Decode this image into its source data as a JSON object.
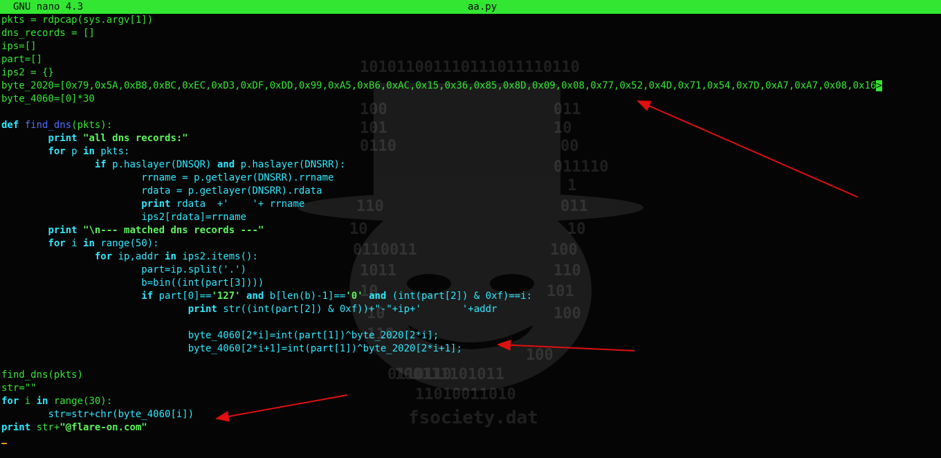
{
  "titlebar": {
    "app": "GNU nano 4.3",
    "file": "aa.py"
  },
  "colors": {
    "accent": "#32e632",
    "keyword": "#2fe8ff",
    "function": "#4f6dff",
    "annotation_arrow": "#e01010"
  },
  "watermark": {
    "binary_rows": [
      "101011001110111011110110",
      "100",
      "011",
      "101",
      "10",
      "0110",
      "00",
      "011110",
      "1",
      "110",
      "011",
      "10",
      "10",
      "0110011",
      "100",
      "1011",
      "110",
      "10",
      "101",
      "10",
      "100",
      "110",
      "100",
      "0110110",
      "100111101011",
      "11010011010"
    ],
    "caption": "fsociety.dat"
  },
  "code": [
    [
      [
        "d",
        "pkts = rdpcap(sys.argv[1])"
      ]
    ],
    [
      [
        "d",
        "dns_records = []"
      ]
    ],
    [
      [
        "d",
        "ips=[]"
      ]
    ],
    [
      [
        "d",
        "part=[]"
      ]
    ],
    [
      [
        "d",
        "ips2 = {}"
      ]
    ],
    [
      [
        "d",
        "byte_2020=[0x79,0x5A,0xB8,0xBC,0xEC,0xD3,0xDF,0xDD,0x99,0xA5,0xB6,0xAC,0x15,0x36,0x85,0x8D,0x09,0x08,0x77,0x52,0x4D,0x71,0x54,0x7D,0xA7,0xA7,0x08,0x16"
      ],
      [
        "m",
        ">"
      ]
    ],
    [
      [
        "d",
        "byte_4060=[0]*30"
      ]
    ],
    [],
    [
      [
        "k",
        "def "
      ],
      [
        "f",
        "find_dns"
      ],
      [
        "d",
        "(pkts):"
      ]
    ],
    [
      [
        "d",
        "        "
      ],
      [
        "k",
        "print "
      ],
      [
        "s",
        "\"all dns records:\""
      ]
    ],
    [
      [
        "d",
        "        "
      ],
      [
        "k",
        "for "
      ],
      [
        "t",
        "p "
      ],
      [
        "k",
        "in "
      ],
      [
        "t",
        "pkts:"
      ]
    ],
    [
      [
        "d",
        "                "
      ],
      [
        "k",
        "if "
      ],
      [
        "t",
        "p.haslayer(DNSQR) "
      ],
      [
        "k",
        "and "
      ],
      [
        "t",
        "p.haslayer(DNSRR):"
      ]
    ],
    [
      [
        "d",
        "                        "
      ],
      [
        "t",
        "rrname = p.getlayer(DNSRR).rrname"
      ]
    ],
    [
      [
        "d",
        "                        "
      ],
      [
        "t",
        "rdata = p.getlayer(DNSRR).rdata"
      ]
    ],
    [
      [
        "d",
        "                        "
      ],
      [
        "k",
        "print "
      ],
      [
        "t",
        "rdata  +'    '+ rrname"
      ]
    ],
    [
      [
        "d",
        "                        "
      ],
      [
        "t",
        "ips2[rdata]=rrname"
      ]
    ],
    [
      [
        "d",
        "        "
      ],
      [
        "k",
        "print "
      ],
      [
        "s",
        "\"\\n--- matched dns records ---\""
      ]
    ],
    [
      [
        "d",
        "        "
      ],
      [
        "k",
        "for "
      ],
      [
        "t",
        "i "
      ],
      [
        "k",
        "in "
      ],
      [
        "t",
        "range(50):"
      ]
    ],
    [
      [
        "d",
        "                "
      ],
      [
        "k",
        "for "
      ],
      [
        "t",
        "ip,addr "
      ],
      [
        "k",
        "in "
      ],
      [
        "t",
        "ips2.items():"
      ]
    ],
    [
      [
        "d",
        "                        "
      ],
      [
        "t",
        "part=ip.split('.')"
      ]
    ],
    [
      [
        "d",
        "                        "
      ],
      [
        "t",
        "b=bin((int(part[3])))"
      ]
    ],
    [
      [
        "d",
        "                        "
      ],
      [
        "k",
        "if "
      ],
      [
        "t",
        "part[0]=="
      ],
      [
        "s",
        "'127'"
      ],
      [
        "t",
        " "
      ],
      [
        "k",
        "and "
      ],
      [
        "t",
        "b[len(b)-1]=="
      ],
      [
        "s",
        "'0'"
      ],
      [
        "t",
        " "
      ],
      [
        "k",
        "and "
      ],
      [
        "t",
        "(int(part[2]) & 0xf)==i:"
      ]
    ],
    [
      [
        "d",
        "                                "
      ],
      [
        "k",
        "print "
      ],
      [
        "t",
        "str((int(part[2]) & 0xf))+\"-\"+ip+'       '+addr"
      ]
    ],
    [],
    [
      [
        "d",
        "                                "
      ],
      [
        "t",
        "byte_4060[2*i]=int(part[1])^byte_2020[2*i];"
      ]
    ],
    [
      [
        "d",
        "                                "
      ],
      [
        "t",
        "byte_4060[2*i+1]=int(part[1])^byte_2020[2*i+1];"
      ]
    ],
    [],
    [
      [
        "d",
        "find_dns(pkts)"
      ]
    ],
    [
      [
        "d",
        "str=\"\""
      ]
    ],
    [
      [
        "k",
        "for "
      ],
      [
        "d",
        "i "
      ],
      [
        "k",
        "in "
      ],
      [
        "d",
        "range(30):"
      ]
    ],
    [
      [
        "d",
        "        "
      ],
      [
        "t",
        "str=str+chr(byte_4060[i])"
      ]
    ],
    [
      [
        "k",
        "print "
      ],
      [
        "d",
        "str+"
      ],
      [
        "s",
        "\"@flare-on.com\""
      ]
    ]
  ]
}
